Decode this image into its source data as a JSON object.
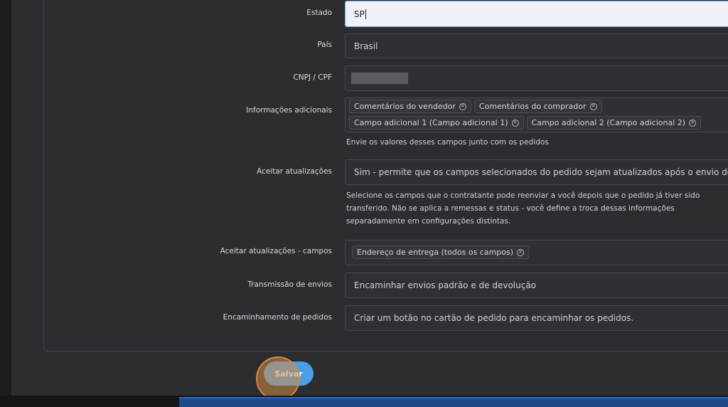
{
  "form": {
    "estado": {
      "label": "Estado",
      "value": "SP"
    },
    "pais": {
      "label": "País",
      "value": "Brasil"
    },
    "cnpj": {
      "label": "CNPJ / CPF",
      "value": ""
    },
    "info_adicionais": {
      "label": "Informações adicionais",
      "tags": [
        "Comentários do vendedor",
        "Comentários do comprador",
        "Campo adicional 1 (Campo adicional 1)",
        "Campo adicional 2 (Campo adicional 2)"
      ],
      "help": "Envie os valores desses campos junto com os pedidos"
    },
    "aceitar_atualizacoes": {
      "label": "Aceitar atualizações",
      "value": "Sim - permite que os campos selecionados do pedido sejam atualizados após o envio do pedido",
      "help": "Selecione os campos que o contratante pode reenviar a você depois que o pedido já tiver sido transferido. Não se aplica a remessas e status - você define a troca dessas informações separadamente em configurações distintas."
    },
    "aceitar_campos": {
      "label": "Aceitar atualizações - campos",
      "tags": [
        "Endereço de entrega (todos os campos)"
      ]
    },
    "transmissao": {
      "label": "Transmissão de envios",
      "value": "Encaminhar envios padrão e de devolução"
    },
    "encaminhamento": {
      "label": "Encaminhamento de pedidos",
      "value": "Criar um botão no cartão de pedido para encaminhar os pedidos."
    }
  },
  "actions": {
    "save_label": "Salvar"
  },
  "icons": {
    "remove_tag": "close-circle-icon"
  },
  "colors": {
    "primary": "#4d9ee8",
    "background": "#2b2d31",
    "click_highlight": "#d8893f"
  }
}
